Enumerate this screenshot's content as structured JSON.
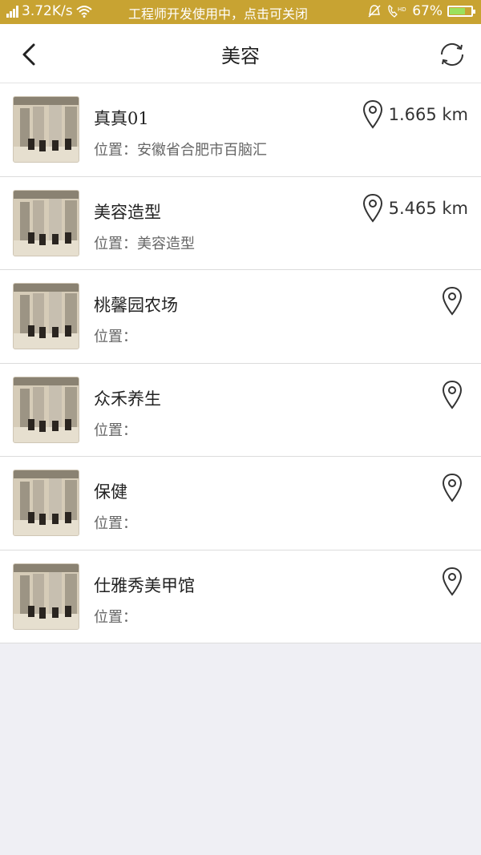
{
  "status_bar": {
    "network_speed": "3.72K/s",
    "notice": "工程师开发使用中，点击可关闭",
    "battery": "67%",
    "battery_level": 0.67
  },
  "header": {
    "title": "美容",
    "back_icon": "chevron-left-icon",
    "refresh_icon": "refresh-icon"
  },
  "shops": [
    {
      "name": "真真01",
      "address": "位置：安徽省合肥市百脑汇",
      "distance": "1.665 km"
    },
    {
      "name": "美容造型",
      "address": "位置：美容造型",
      "distance": "5.465 km"
    },
    {
      "name": "桃馨园农场",
      "address": "位置：",
      "distance": ""
    },
    {
      "name": "众禾养生",
      "address": "位置：",
      "distance": ""
    },
    {
      "name": "保健",
      "address": "位置：",
      "distance": ""
    },
    {
      "name": "仕雅秀美甲馆",
      "address": "位置：",
      "distance": ""
    }
  ],
  "colors": {
    "status_bar": "#c8a332",
    "background": "#efeff4",
    "card": "#ffffff"
  }
}
